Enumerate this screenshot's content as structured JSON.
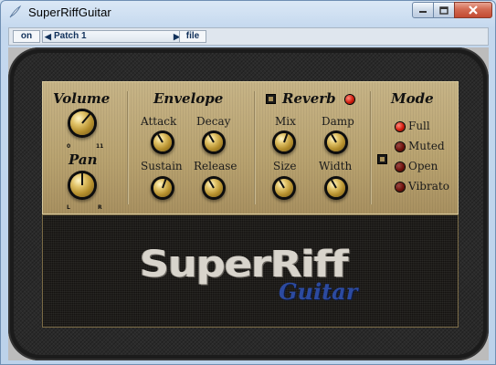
{
  "window": {
    "title": "SuperRiffGuitar",
    "icon": "feather-icon",
    "controls": [
      "minimize-icon",
      "maximize-icon",
      "close-icon"
    ]
  },
  "toolbar": {
    "power_label": "on",
    "patch_label": "Patch   1",
    "file_label": "file"
  },
  "sections": {
    "volume": {
      "title": "Volume",
      "min_label": "0",
      "max_label": "11"
    },
    "pan": {
      "title": "Pan",
      "left_label": "L",
      "right_label": "R"
    },
    "envelope": {
      "title": "Envelope",
      "attack": "Attack",
      "decay": "Decay",
      "sustain": "Sustain",
      "release": "Release"
    },
    "reverb": {
      "title": "Reverb",
      "mix": "Mix",
      "damp": "Damp",
      "size": "Size",
      "width": "Width"
    },
    "mode": {
      "title": "Mode",
      "options": [
        "Full",
        "Muted",
        "Open",
        "Vibrato"
      ],
      "selected": "Full"
    }
  },
  "logo": {
    "main": "SuperRiff",
    "sub": "Guitar"
  },
  "colors": {
    "panel": "#b8a26f",
    "led_on": "#d21a0c",
    "logo_blue": "#2c4aa0"
  }
}
